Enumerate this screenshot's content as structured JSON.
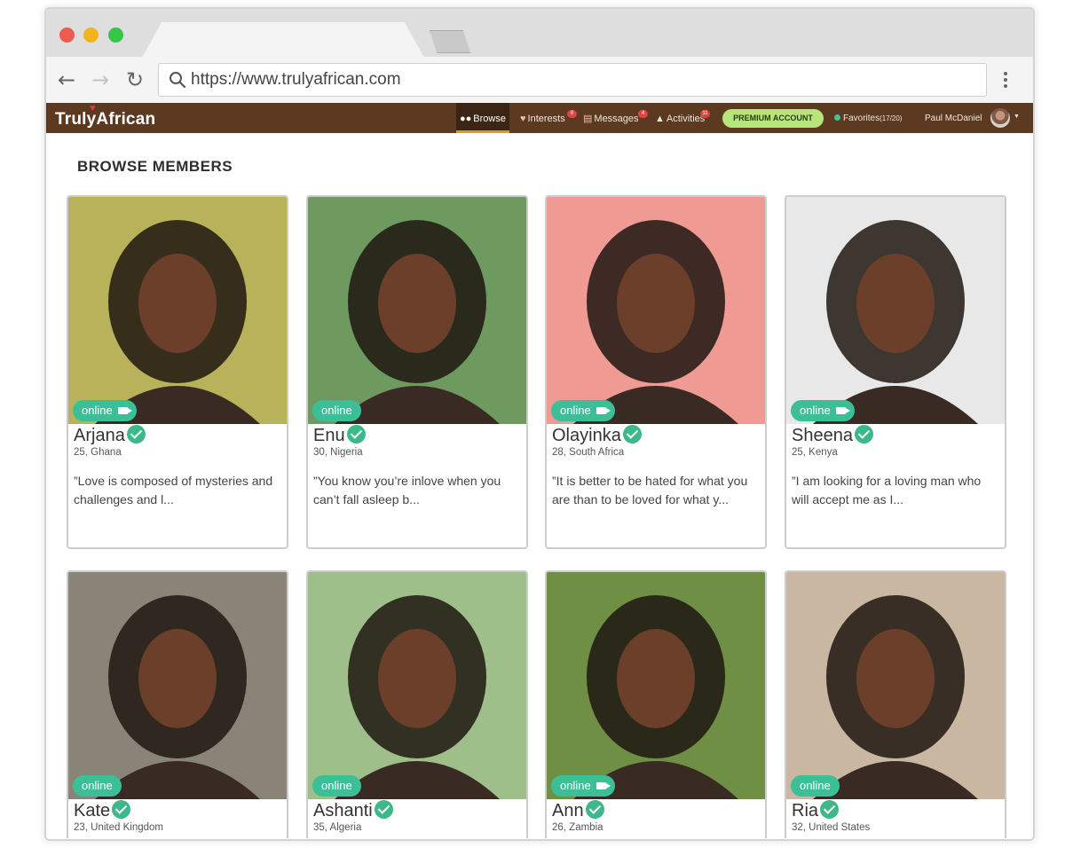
{
  "browser": {
    "url": "https://www.trulyafrican.com"
  },
  "site_nav": {
    "logo": "TrulyAfrican",
    "browse": "Browse",
    "interests": "Interests",
    "interests_badge": "8",
    "messages": "Messages",
    "messages_badge": "4",
    "activities": "Activities",
    "activities_badge": "11",
    "premium": "PREMIUM ACCOUNT",
    "favorites": "Favorites",
    "favorites_count": "(17/20)",
    "user_name": "Paul McDaniel"
  },
  "page": {
    "title": "BROWSE MEMBERS",
    "online_label": "online"
  },
  "members": [
    {
      "name": "Arjana",
      "meta": "25, Ghana",
      "quote": "”Love is composed of mysteries and challenges and l...",
      "video": true,
      "bg": "#b8b25a"
    },
    {
      "name": "Enu",
      "meta": "30, Nigeria",
      "quote": "”You know you’re inlove when you can’t fall asleep b...",
      "video": false,
      "bg": "#6f9a5f"
    },
    {
      "name": "Olayinka",
      "meta": "28, South Africa",
      "quote": "”It is better to be hated for what you are than to be loved for what y...",
      "video": true,
      "bg": "#ef9a93"
    },
    {
      "name": "Sheena",
      "meta": "25, Kenya",
      "quote": "”I am looking for a loving man who will accept me as I...",
      "video": true,
      "bg": "#e8e8e8"
    },
    {
      "name": "Kate",
      "meta": "23, United Kingdom",
      "video": false,
      "bg": "#8a8478"
    },
    {
      "name": "Ashanti",
      "meta": "35, Algeria",
      "video": false,
      "bg": "#9fbf8a"
    },
    {
      "name": "Ann",
      "meta": "26, Zambia",
      "video": true,
      "bg": "#6f8f44"
    },
    {
      "name": "Ria",
      "meta": "32, United States",
      "video": false,
      "bg": "#c9b7a2"
    }
  ]
}
